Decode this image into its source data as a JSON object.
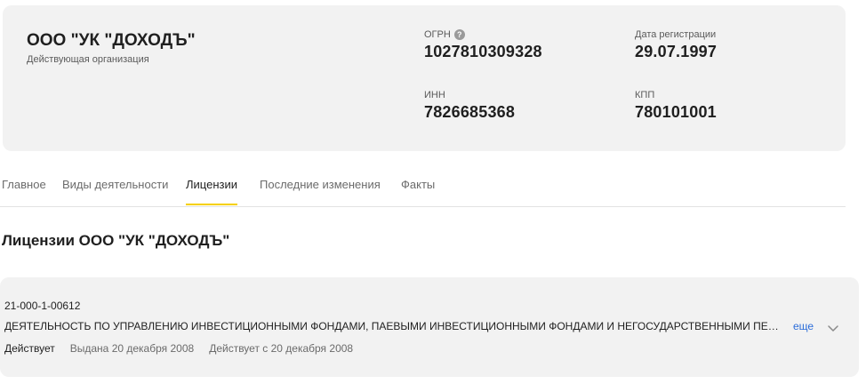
{
  "organization": {
    "name": "ООО \"УК \"ДОХОДЪ\"",
    "status": "Действующая организация"
  },
  "fields": {
    "ogrn": {
      "label": "ОГРН",
      "value": "1027810309328"
    },
    "registration_date": {
      "label": "Дата регистрации",
      "value": "29.07.1997"
    },
    "inn": {
      "label": "ИНН",
      "value": "7826685368"
    },
    "kpp": {
      "label": "КПП",
      "value": "780101001"
    }
  },
  "icons": {
    "help": "?"
  },
  "tabs": [
    {
      "label": "Главное",
      "active": false
    },
    {
      "label": "Виды деятельности",
      "active": false
    },
    {
      "label": "Лицензии",
      "active": true
    },
    {
      "label": "Последние изменения",
      "active": false
    },
    {
      "label": "Факты",
      "active": false
    }
  ],
  "section": {
    "title": "Лицензии ООО \"УК \"ДОХОДЪ\""
  },
  "license": {
    "number": "21-000-1-00612",
    "activity": "ДЕЯТЕЛЬНОСТЬ ПО УПРАВЛЕНИЮ ИНВЕСТИЦИОННЫМИ ФОНДАМИ, ПАЕВЫМИ ИНВЕСТИЦИОННЫМИ ФОНДАМИ И НЕГОСУДАРСТВЕННЫМИ ПЕНСИОННЫМИ ФОНДАМИ",
    "more_label": "еще",
    "status": "Действует",
    "issued": "Выдана 20 декабря 2008",
    "valid_from": "Действует с 20 декабря 2008"
  },
  "colors": {
    "accent": "#f5d000",
    "link": "#2b6cd9",
    "card_bg": "#f2f2f2"
  }
}
